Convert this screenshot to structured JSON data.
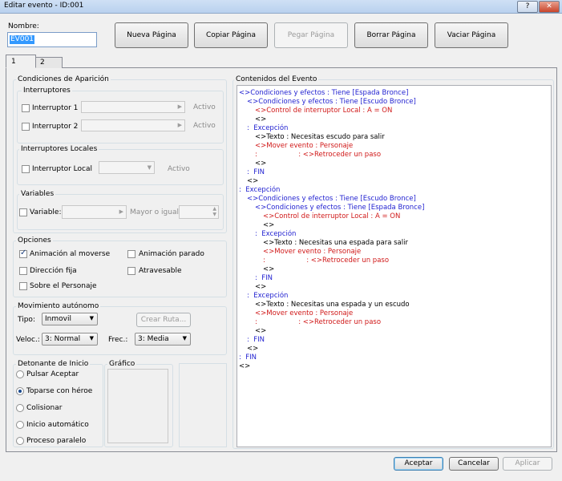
{
  "window": {
    "title": "Editar evento - ID:001",
    "help_btn": "?",
    "close_btn": "✕"
  },
  "name_label": "Nombre:",
  "name_value": "EV001",
  "toolbar": {
    "new_page": "Nueva Página",
    "copy_page": "Copiar Página",
    "paste_page": "Pegar Página",
    "delete_page": "Borrar Página",
    "clear_page": "Vaciar Página"
  },
  "tabs": [
    "1",
    "2"
  ],
  "conditions": {
    "title": "Condiciones de Aparición",
    "switches": {
      "title": "Interruptores",
      "switch1": "Interruptor 1",
      "switch2": "Interruptor 2",
      "active1": "Activo",
      "active2": "Activo"
    },
    "local_switches": {
      "title": "Interruptores Locales",
      "label": "Interruptor Local",
      "active": "Activo"
    },
    "variables": {
      "title": "Variables",
      "label": "Variable:",
      "comparison": "Mayor o igual"
    }
  },
  "options": {
    "title": "Opciones",
    "walk_anim": "Animación al moverse",
    "step_anim": "Animación parado",
    "direction_fix": "Dirección fija",
    "through": "Atravesable",
    "always_on_top": "Sobre el Personaje"
  },
  "autonomous": {
    "title": "Movimiento autónomo",
    "type_label": "Tipo:",
    "type_value": "Inmovil",
    "route_button": "Crear Ruta...",
    "speed_label": "Veloc.:",
    "speed_value": "3: Normal",
    "freq_label": "Frec.:",
    "freq_value": "3: Media"
  },
  "trigger": {
    "title": "Detonante de Inicio",
    "options": [
      "Pulsar Aceptar",
      "Toparse con héroe",
      "Colisionar",
      "Inicio automático",
      "Proceso paralelo"
    ]
  },
  "graphic": {
    "title": "Gráfico"
  },
  "contents": {
    "title": "Contenidos del Evento",
    "lines": [
      {
        "text": "<>Condiciones y efectos : Tiene [Espada Bronce]",
        "color": "blue",
        "indent": 0
      },
      {
        "text": "<>Condiciones y efectos : Tiene [Escudo Bronce]",
        "color": "blue",
        "indent": 1
      },
      {
        "text": "<>Control de interruptor Local : A = ON",
        "color": "red",
        "indent": 2
      },
      {
        "text": "<>",
        "color": "blk",
        "indent": 2
      },
      {
        "text": ":  Excepción",
        "color": "blue",
        "indent": 1
      },
      {
        "text": "<>Texto : Necesitas escudo para salir",
        "color": "blk",
        "indent": 2
      },
      {
        "text": "<>Mover evento : Personaje",
        "color": "red",
        "indent": 2
      },
      {
        "text": ":                   : <>Retroceder un paso",
        "color": "red",
        "indent": 2
      },
      {
        "text": "<>",
        "color": "blk",
        "indent": 2
      },
      {
        "text": ":  FIN",
        "color": "blue",
        "indent": 1
      },
      {
        "text": "<>",
        "color": "blk",
        "indent": 1
      },
      {
        "text": ":  Excepción",
        "color": "blue",
        "indent": 0
      },
      {
        "text": "<>Condiciones y efectos : Tiene [Escudo Bronce]",
        "color": "blue",
        "indent": 1
      },
      {
        "text": "<>Condiciones y efectos : Tiene [Espada Bronce]",
        "color": "blue",
        "indent": 2
      },
      {
        "text": "<>Control de interruptor Local : A = ON",
        "color": "red",
        "indent": 3
      },
      {
        "text": "<>",
        "color": "blk",
        "indent": 3
      },
      {
        "text": ":  Excepción",
        "color": "blue",
        "indent": 2
      },
      {
        "text": "<>Texto : Necesitas una espada para salir",
        "color": "blk",
        "indent": 3
      },
      {
        "text": "<>Mover evento : Personaje",
        "color": "red",
        "indent": 3
      },
      {
        "text": ":                   : <>Retroceder un paso",
        "color": "red",
        "indent": 3
      },
      {
        "text": "<>",
        "color": "blk",
        "indent": 3
      },
      {
        "text": ":  FIN",
        "color": "blue",
        "indent": 2
      },
      {
        "text": "<>",
        "color": "blk",
        "indent": 2
      },
      {
        "text": ":  Excepción",
        "color": "blue",
        "indent": 1
      },
      {
        "text": "<>Texto : Necesitas una espada y un escudo",
        "color": "blk",
        "indent": 2
      },
      {
        "text": "<>Mover evento : Personaje",
        "color": "red",
        "indent": 2
      },
      {
        "text": ":                   : <>Retroceder un paso",
        "color": "red",
        "indent": 2
      },
      {
        "text": "<>",
        "color": "blk",
        "indent": 2
      },
      {
        "text": ":  FIN",
        "color": "blue",
        "indent": 1
      },
      {
        "text": "<>",
        "color": "blk",
        "indent": 1
      },
      {
        "text": ":  FIN",
        "color": "blue",
        "indent": 0
      },
      {
        "text": "<>",
        "color": "blk",
        "indent": 0
      }
    ]
  },
  "footer": {
    "accept": "Aceptar",
    "cancel": "Cancelar",
    "apply": "Aplicar"
  }
}
